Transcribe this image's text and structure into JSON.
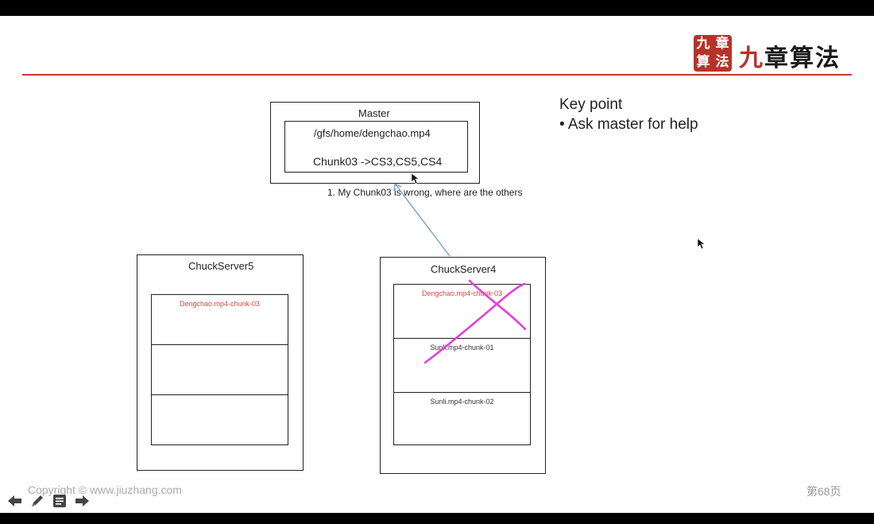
{
  "logo": {
    "seal_chars": [
      "九",
      "章",
      "算",
      "法"
    ],
    "wordmark_chars": [
      "九",
      "章算法"
    ]
  },
  "master": {
    "title": "Master",
    "file_path": "/gfs/home/dengchao.mp4",
    "chunk_mapping": "Chunk03 ->CS3,CS5,CS4"
  },
  "annotation": "1. My Chunk03 is wrong, where are the others",
  "chunkservers": [
    {
      "title": "ChuckServer5",
      "chunks": [
        "Dengchao.mp4-chunk-03",
        "",
        ""
      ]
    },
    {
      "title": "ChuckServer4",
      "chunks": [
        "Dengchao.mp4-chunk-03",
        "Sunli.mp4-chunk-01",
        "Sunli.mp4-chunk-02"
      ]
    }
  ],
  "keypoint": {
    "heading": "Key point",
    "bullets": [
      "• Ask master for help"
    ]
  },
  "footer": {
    "copyright": "Copyright © www.jiuzhang.com",
    "page": "第68页"
  },
  "toolbar": {
    "icons": [
      "arrow-left-icon",
      "pencil-icon",
      "menu-icon",
      "arrow-right-icon"
    ]
  },
  "colors": {
    "accent_red": "#c0392b",
    "chunk_red": "#d9473d",
    "arrow_blue": "#6b9bc7",
    "marker_magenta": "#e040e0"
  }
}
